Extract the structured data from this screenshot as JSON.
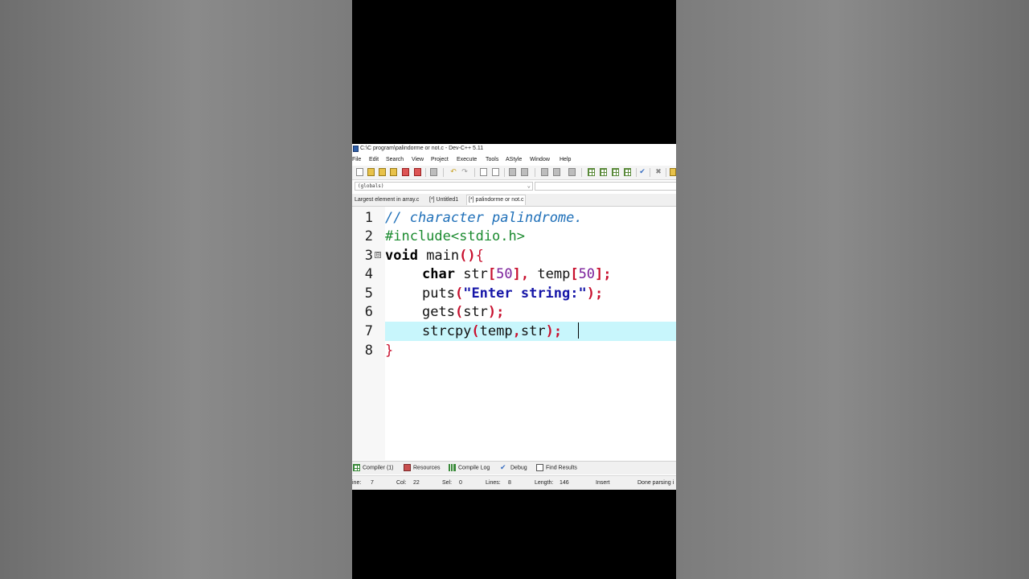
{
  "window": {
    "title": "C:\\C program\\palindorme or not.c - Dev-C++ 5.11"
  },
  "menu": [
    "File",
    "Edit",
    "Search",
    "View",
    "Project",
    "Execute",
    "Tools",
    "AStyle",
    "Window",
    "Help"
  ],
  "scope_combo": {
    "value": "(globals)"
  },
  "tabs": [
    {
      "label": "Largest element in array.c"
    },
    {
      "label": "[*] Untitled1"
    },
    {
      "label": "[*] palindorme or not.c"
    }
  ],
  "editor": {
    "line_numbers": [
      "1",
      "2",
      "3",
      "4",
      "5",
      "6",
      "7",
      "8"
    ],
    "fold_marker": "⊟",
    "lines": {
      "l1": {
        "comment": "// character palindrome."
      },
      "l2": {
        "preproc": "#include<stdio.h>"
      },
      "l3": {
        "kw": "void",
        "name": " main",
        "paren": "()",
        "brace": "{"
      },
      "l4": {
        "kw": "char",
        "a": " str",
        "b1": "[",
        "n1": "50",
        "b2": "],",
        "c": " temp",
        "b3": "[",
        "n2": "50",
        "b4": "];"
      },
      "l5": {
        "fn": "puts",
        "p1": "(",
        "str": "\"Enter string:\"",
        "p2": ");"
      },
      "l6": {
        "fn": "gets",
        "p1": "(",
        "arg": "str",
        "p2": ");"
      },
      "l7": {
        "fn": "strcpy",
        "p1": "(",
        "a1": "temp",
        "comma": ",",
        "a2": "str",
        "p2": ");"
      },
      "l8": {
        "brace": "}"
      }
    }
  },
  "bottom_tabs": [
    "Compiler (1)",
    "Resources",
    "Compile Log",
    "Debug",
    "Find Results"
  ],
  "status": {
    "line_label": "ine:",
    "line_value": "7",
    "col_label": "Col:",
    "col_value": "22",
    "sel_label": "Sel:",
    "sel_value": "0",
    "lines_label": "Lines:",
    "lines_value": "8",
    "length_label": "Length:",
    "length_value": "146",
    "mode": "Insert",
    "message": "Done parsing i"
  }
}
